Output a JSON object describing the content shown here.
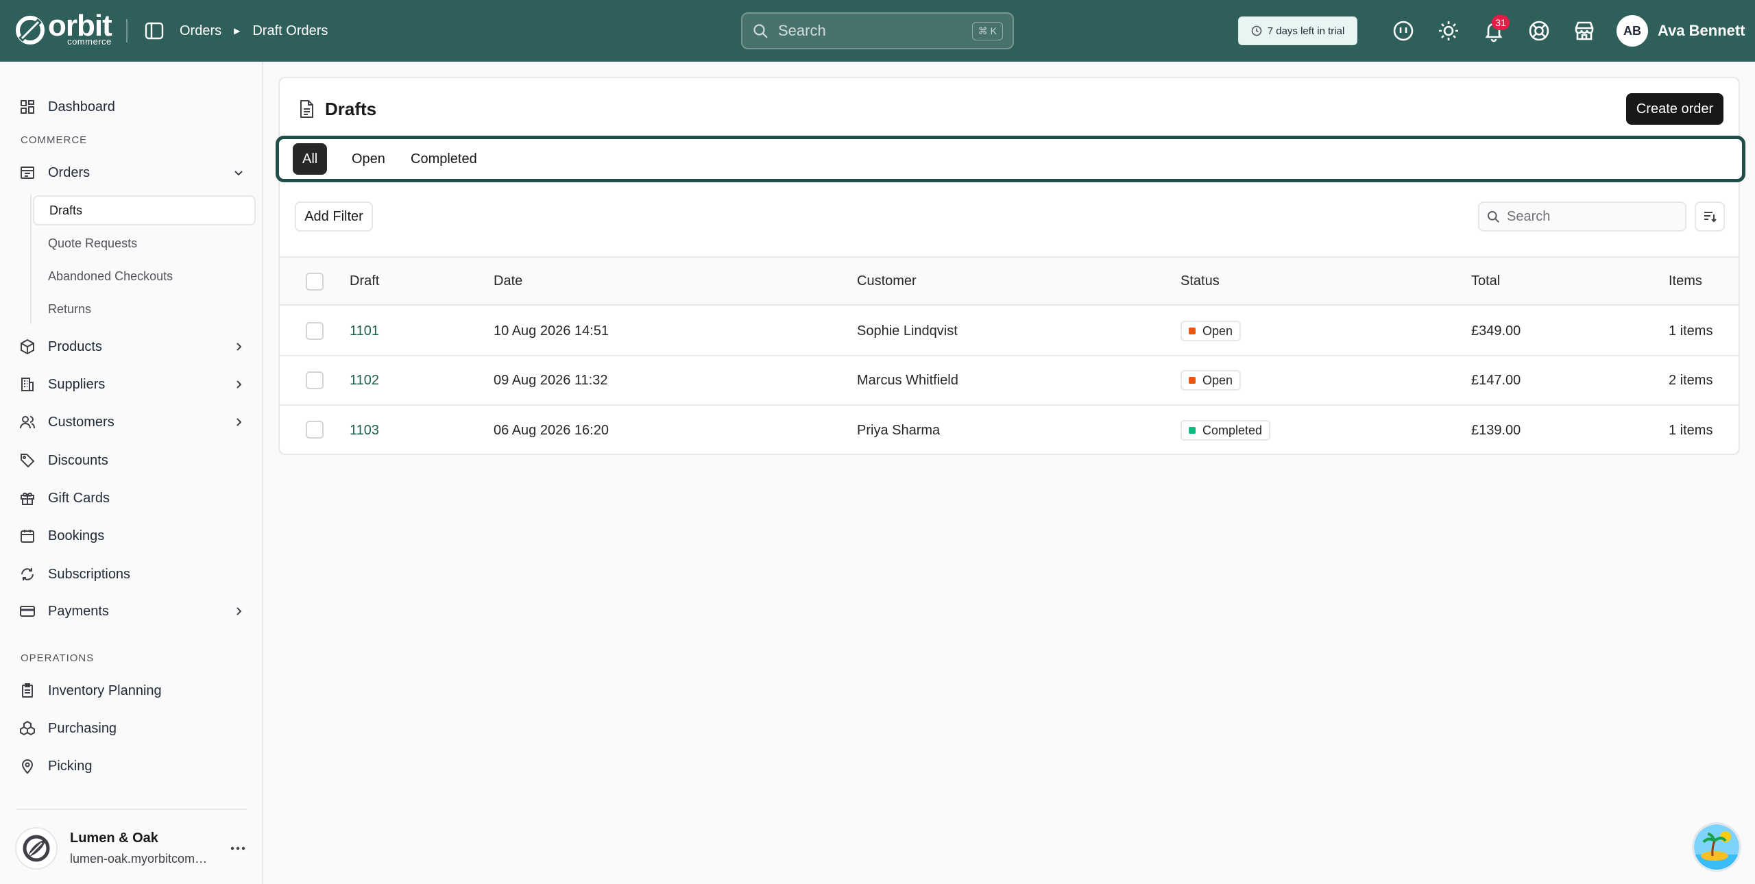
{
  "brand": {
    "word": "orbit",
    "sub": "commerce"
  },
  "breadcrumb": {
    "parent": "Orders",
    "current": "Draft Orders"
  },
  "global_search": {
    "placeholder": "Search",
    "shortcut": "⌘ K"
  },
  "trial": {
    "label": "7 days left in trial"
  },
  "notifications": {
    "count": "31"
  },
  "user": {
    "initials": "AB",
    "name": "Ava Bennett"
  },
  "sidebar": {
    "dashboard": "Dashboard",
    "section_commerce": "COMMERCE",
    "orders": "Orders",
    "orders_sub": [
      "Drafts",
      "Quote Requests",
      "Abandoned Checkouts",
      "Returns"
    ],
    "products": "Products",
    "suppliers": "Suppliers",
    "customers": "Customers",
    "discounts": "Discounts",
    "gift_cards": "Gift Cards",
    "bookings": "Bookings",
    "subscriptions": "Subscriptions",
    "payments": "Payments",
    "section_operations": "OPERATIONS",
    "inventory_planning": "Inventory Planning",
    "purchasing": "Purchasing",
    "picking": "Picking",
    "store": {
      "name": "Lumen & Oak",
      "url": "lumen-oak.myorbitcommerce.com"
    }
  },
  "page": {
    "title": "Drafts",
    "create_button": "Create order",
    "tabs": [
      "All",
      "Open",
      "Completed"
    ],
    "active_tab": "All",
    "add_filter": "Add Filter",
    "table_search_placeholder": "Search"
  },
  "table": {
    "columns": [
      "Draft",
      "Date",
      "Customer",
      "Status",
      "Total",
      "Items"
    ],
    "rows": [
      {
        "draft": "1101",
        "date": "10 Aug 2026 14:51",
        "customer": "Sophie Lindqvist",
        "status": "Open",
        "total": "£349.00",
        "items": "1 items"
      },
      {
        "draft": "1102",
        "date": "09 Aug 2026 11:32",
        "customer": "Marcus Whitfield",
        "status": "Open",
        "total": "£147.00",
        "items": "2 items"
      },
      {
        "draft": "1103",
        "date": "06 Aug 2026 16:20",
        "customer": "Priya Sharma",
        "status": "Completed",
        "total": "£139.00",
        "items": "1 items"
      }
    ]
  },
  "colors": {
    "topbar": "#2f5f5b",
    "status_open": "#ea580c",
    "status_completed": "#10b981",
    "tab_focus_ring": "#1f4d47"
  }
}
